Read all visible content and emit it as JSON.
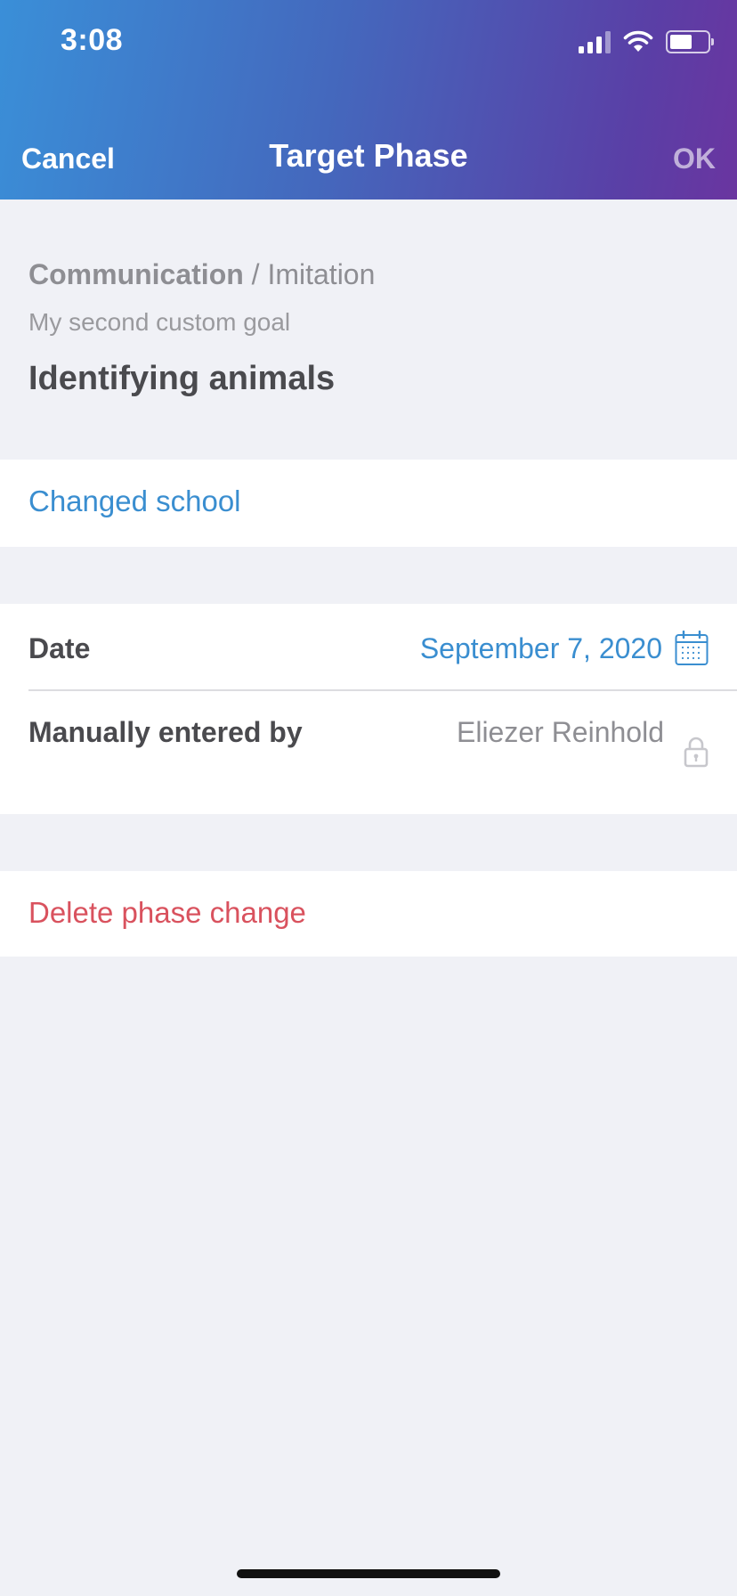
{
  "status_bar": {
    "time": "3:08"
  },
  "nav": {
    "cancel_label": "Cancel",
    "title": "Target Phase",
    "ok_label": "OK"
  },
  "breadcrumb": {
    "domain": "Communication",
    "separator": " / ",
    "subdomain": "Imitation"
  },
  "goal": "My second custom goal",
  "target": "Identifying animals",
  "reason": "Changed school",
  "details": {
    "date_label": "Date",
    "date_value": "September 7, 2020",
    "manual_label": "Manually entered by",
    "manual_value": "Eliezer Reinhold"
  },
  "delete_label": "Delete phase change",
  "colors": {
    "accent": "#3a8ed0",
    "destructive": "#d9525e",
    "background": "#f0f1f6"
  }
}
